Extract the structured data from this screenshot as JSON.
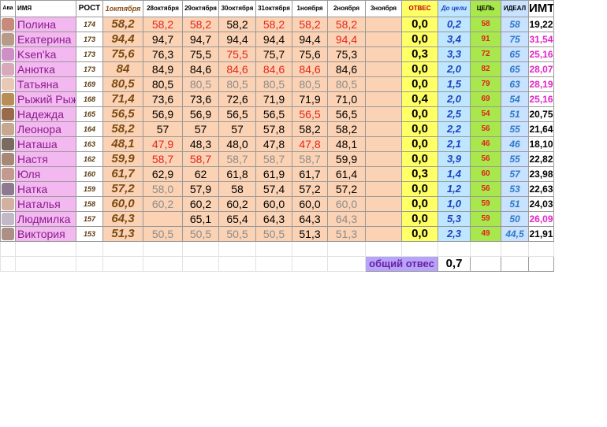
{
  "header": {
    "ava": "Ава",
    "name": "ИМЯ",
    "rost": "РОСТ",
    "dates": [
      "1октября",
      "28октября",
      "29октября",
      "30октября",
      "31октября",
      "1ноября",
      "2ноября",
      "3ноября"
    ],
    "otves": "ОТВЕС",
    "do_celi": "До цели",
    "cel": "ЦЕЛЬ",
    "ideal": "ИДЕАЛ",
    "imt": "ИМТ"
  },
  "rows": [
    {
      "name": "Полина",
      "rost": "174",
      "w1": "58,2",
      "w": [
        [
          "58,2",
          "red"
        ],
        [
          "58,2",
          "red"
        ],
        [
          "58,2",
          ""
        ],
        [
          "58,2",
          "red"
        ],
        [
          "58,2",
          "red"
        ],
        [
          "58,2",
          "red"
        ],
        [
          "",
          ""
        ]
      ],
      "otves": "0,0",
      "do_celi": "0,2",
      "cel": "58",
      "ideal": "58",
      "imt": "19,22",
      "imt_style": ""
    },
    {
      "name": "Екатерина",
      "rost": "173",
      "w1": "94,4",
      "w": [
        [
          "94,7",
          ""
        ],
        [
          "94,7",
          ""
        ],
        [
          "94,4",
          ""
        ],
        [
          "94,4",
          ""
        ],
        [
          "94,4",
          ""
        ],
        [
          "94,4",
          "red"
        ],
        [
          "",
          ""
        ]
      ],
      "otves": "0,0",
      "do_celi": "3,4",
      "cel": "91",
      "ideal": "75",
      "imt": "31,54",
      "imt_style": "pink"
    },
    {
      "name": "Ksen'ka",
      "rost": "173",
      "w1": "75,6",
      "w": [
        [
          "76,3",
          ""
        ],
        [
          "75,5",
          ""
        ],
        [
          "75,5",
          "red"
        ],
        [
          "75,7",
          ""
        ],
        [
          "75,6",
          ""
        ],
        [
          "75,3",
          ""
        ],
        [
          "",
          ""
        ]
      ],
      "otves": "0,3",
      "do_celi": "3,3",
      "cel": "72",
      "ideal": "65",
      "imt": "25,16",
      "imt_style": "pink"
    },
    {
      "name": "Анютка",
      "rost": "173",
      "w1": "84",
      "w": [
        [
          "84,9",
          ""
        ],
        [
          "84,6",
          ""
        ],
        [
          "84,6",
          "red"
        ],
        [
          "84,6",
          "red"
        ],
        [
          "84,6",
          "red"
        ],
        [
          "84,6",
          ""
        ],
        [
          "",
          ""
        ]
      ],
      "otves": "0,0",
      "do_celi": "2,0",
      "cel": "82",
      "ideal": "65",
      "imt": "28,07",
      "imt_style": "pink"
    },
    {
      "name": "Татьяна",
      "rost": "169",
      "w1": "80,5",
      "w": [
        [
          "80,5",
          ""
        ],
        [
          "80,5",
          "gray"
        ],
        [
          "80,5",
          "gray"
        ],
        [
          "80,5",
          "gray"
        ],
        [
          "80,5",
          "gray"
        ],
        [
          "80,5",
          "gray"
        ],
        [
          "",
          ""
        ]
      ],
      "otves": "0,0",
      "do_celi": "1,5",
      "cel": "79",
      "ideal": "63",
      "imt": "28,19",
      "imt_style": "pink"
    },
    {
      "name": "Рыжий Рыж",
      "rost": "168",
      "w1": "71,4",
      "w": [
        [
          "73,6",
          ""
        ],
        [
          "73,6",
          ""
        ],
        [
          "72,6",
          ""
        ],
        [
          "71,9",
          ""
        ],
        [
          "71,9",
          ""
        ],
        [
          "71,0",
          ""
        ],
        [
          "",
          ""
        ]
      ],
      "otves": "0,4",
      "do_celi": "2,0",
      "cel": "69",
      "ideal": "54",
      "imt": "25,16",
      "imt_style": "pink"
    },
    {
      "name": "Надежда",
      "rost": "165",
      "w1": "56,5",
      "w": [
        [
          "56,9",
          ""
        ],
        [
          "56,9",
          ""
        ],
        [
          "56,5",
          ""
        ],
        [
          "56,5",
          ""
        ],
        [
          "56,5",
          "red"
        ],
        [
          "56,5",
          ""
        ],
        [
          "",
          ""
        ]
      ],
      "otves": "0,0",
      "do_celi": "2,5",
      "cel": "54",
      "ideal": "51",
      "imt": "20,75",
      "imt_style": ""
    },
    {
      "name": "Леонора",
      "rost": "164",
      "w1": "58,2",
      "w": [
        [
          "57",
          ""
        ],
        [
          "57",
          ""
        ],
        [
          "57",
          ""
        ],
        [
          "57,8",
          ""
        ],
        [
          "58,2",
          ""
        ],
        [
          "58,2",
          ""
        ],
        [
          "",
          ""
        ]
      ],
      "otves": "0,0",
      "do_celi": "2,2",
      "cel": "56",
      "ideal": "55",
      "imt": "21,64",
      "imt_style": ""
    },
    {
      "name": "Наташа",
      "rost": "163",
      "w1": "48,1",
      "w": [
        [
          "47,9",
          "red"
        ],
        [
          "48,3",
          ""
        ],
        [
          "48,0",
          ""
        ],
        [
          "47,8",
          ""
        ],
        [
          "47,8",
          "red"
        ],
        [
          "48,1",
          ""
        ],
        [
          "",
          ""
        ]
      ],
      "otves": "0,0",
      "do_celi": "2,1",
      "cel": "46",
      "ideal": "46",
      "imt": "18,10",
      "imt_style": ""
    },
    {
      "name": "Настя",
      "rost": "162",
      "w1": "59,9",
      "w": [
        [
          "58,7",
          "red"
        ],
        [
          "58,7",
          "red"
        ],
        [
          "58,7",
          "gray"
        ],
        [
          "58,7",
          "gray"
        ],
        [
          "58,7",
          "gray"
        ],
        [
          "59,9",
          ""
        ],
        [
          "",
          ""
        ]
      ],
      "otves": "0,0",
      "do_celi": "3,9",
      "cel": "56",
      "ideal": "55",
      "imt": "22,82",
      "imt_style": ""
    },
    {
      "name": "Юля",
      "rost": "160",
      "w1": "61,7",
      "w": [
        [
          "62,9",
          ""
        ],
        [
          "62",
          ""
        ],
        [
          "61,8",
          ""
        ],
        [
          "61,9",
          ""
        ],
        [
          "61,7",
          ""
        ],
        [
          "61,4",
          ""
        ],
        [
          "",
          ""
        ]
      ],
      "otves": "0,3",
      "do_celi": "1,4",
      "cel": "60",
      "ideal": "57",
      "imt": "23,98",
      "imt_style": ""
    },
    {
      "name": "Натка",
      "rost": "159",
      "w1": "57,2",
      "w": [
        [
          "58,0",
          "gray"
        ],
        [
          "57,9",
          ""
        ],
        [
          "58",
          ""
        ],
        [
          "57,4",
          ""
        ],
        [
          "57,2",
          ""
        ],
        [
          "57,2",
          ""
        ],
        [
          "",
          ""
        ]
      ],
      "otves": "0,0",
      "do_celi": "1,2",
      "cel": "56",
      "ideal": "53",
      "imt": "22,63",
      "imt_style": ""
    },
    {
      "name": "Наталья",
      "rost": "158",
      "w1": "60,0",
      "w": [
        [
          "60,2",
          "gray"
        ],
        [
          "60,2",
          ""
        ],
        [
          "60,2",
          ""
        ],
        [
          "60,0",
          ""
        ],
        [
          "60,0",
          ""
        ],
        [
          "60,0",
          "gray"
        ],
        [
          "",
          ""
        ]
      ],
      "otves": "0,0",
      "do_celi": "1,0",
      "cel": "59",
      "ideal": "51",
      "imt": "24,03",
      "imt_style": ""
    },
    {
      "name": "Людмилка",
      "rost": "157",
      "w1": "64,3",
      "w": [
        [
          "",
          ""
        ],
        [
          "65,1",
          ""
        ],
        [
          "65,4",
          ""
        ],
        [
          "64,3",
          ""
        ],
        [
          "64,3",
          ""
        ],
        [
          "64,3",
          "gray"
        ],
        [
          "",
          ""
        ]
      ],
      "otves": "0,0",
      "do_celi": "5,3",
      "cel": "59",
      "ideal": "50",
      "imt": "26,09",
      "imt_style": "pink"
    },
    {
      "name": "Виктория",
      "rost": "153",
      "w1": "51,3",
      "w": [
        [
          "50,5",
          "gray"
        ],
        [
          "50,5",
          "gray"
        ],
        [
          "50,5",
          "gray"
        ],
        [
          "50,5",
          "gray"
        ],
        [
          "51,3",
          ""
        ],
        [
          "51,3",
          "gray"
        ],
        [
          "",
          ""
        ]
      ],
      "otves": "0,0",
      "do_celi": "2,3",
      "cel": "49",
      "ideal": "44,5",
      "imt": "21,91",
      "imt_style": ""
    }
  ],
  "total": {
    "label": "общий отвес",
    "value": "0,7"
  },
  "avatar_colors": [
    "#c88a7a",
    "#b99a88",
    "#cf8fc6",
    "#d7a9bb",
    "#e9c9b5",
    "#b98d55",
    "#9a6b4a",
    "#c7a78f",
    "#7a6a5f",
    "#a98776",
    "#c59a8e",
    "#8e7a8f",
    "#d4b0a0",
    "#c2b8c8",
    "#ad8f86"
  ],
  "colors": {
    "name_bg": "#f2b8ef",
    "weights_bg": "#fbd2b4",
    "otves_bg": "#ffff66",
    "do_celi_bg": "#bfe6ff",
    "cel_bg": "#a9e84c",
    "ideal_bg": "#c8e2ff",
    "total_label_bg": "#b7a3f7",
    "red_text": "#e3261c",
    "gray_text": "#8c8c8c"
  }
}
